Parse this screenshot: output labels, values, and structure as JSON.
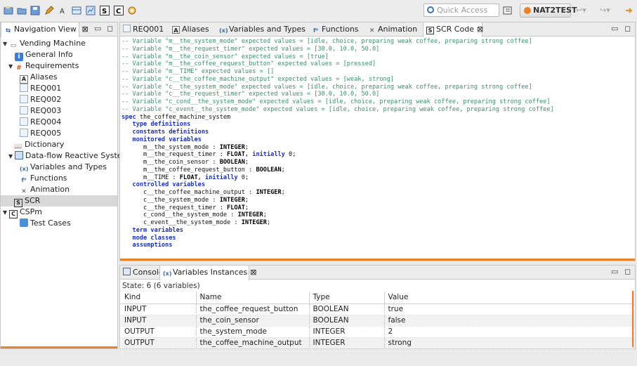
{
  "toolbar": {
    "quick_access_placeholder": "Quick Access",
    "perspective_label": "NAT2TEST"
  },
  "nav": {
    "tab_label": "Navigation View",
    "items": [
      {
        "label": "Vending Machine",
        "icon": "folder-icon"
      },
      {
        "label": "General Info",
        "icon": "info-icon"
      },
      {
        "label": "Requirements",
        "icon": "requirements-icon"
      },
      {
        "label": "Aliases",
        "icon": "aliases-icon"
      },
      {
        "label": "REQ001",
        "icon": "document-icon"
      },
      {
        "label": "REQ002",
        "icon": "document-icon"
      },
      {
        "label": "REQ003",
        "icon": "document-icon"
      },
      {
        "label": "REQ004",
        "icon": "document-icon"
      },
      {
        "label": "REQ005",
        "icon": "document-icon"
      },
      {
        "label": "Dictionary",
        "icon": "dictionary-icon"
      },
      {
        "label": "Data-flow Reactive System",
        "icon": "dfrs-icon"
      },
      {
        "label": "Variables and Types",
        "icon": "variables-icon"
      },
      {
        "label": "Functions",
        "icon": "functions-icon"
      },
      {
        "label": "Animation",
        "icon": "animation-icon"
      },
      {
        "label": "SCR",
        "icon": "scr-icon"
      },
      {
        "label": "CSPm",
        "icon": "cspm-icon"
      },
      {
        "label": "Test Cases",
        "icon": "test-cases-icon"
      }
    ]
  },
  "editor": {
    "tabs": [
      "REQ001",
      "Aliases",
      "Variables and Types",
      "Functions",
      "Animation",
      "SCR Code"
    ],
    "code_lines": [
      {
        "t": "c",
        "s": "-- Variable \"m__the_system_mode\" expected values = [idle, choice, preparing weak coffee, preparing strong coffee]"
      },
      {
        "t": "c",
        "s": "-- Variable \"m__the_request_timer\" expected values = [30.0, 10.0, 50.0]"
      },
      {
        "t": "c",
        "s": "-- Variable \"m__the_coin_sensor\" expected values = [true]"
      },
      {
        "t": "c",
        "s": "-- Variable \"m__the_coffee_request_button\" expected values = [pressed]"
      },
      {
        "t": "c",
        "s": "-- Variable \"m__TIME\" expected values = []"
      },
      {
        "t": "c",
        "s": "-- Variable \"c__the_coffee_machine_output\" expected values = [weak, strong]"
      },
      {
        "t": "c",
        "s": "-- Variable \"c__the_system_mode\" expected values = [idle, choice, preparing weak coffee, preparing strong coffee]"
      },
      {
        "t": "c",
        "s": "-- Variable \"c__the_request_timer\" expected values = [30.0, 10.0, 50.0]"
      },
      {
        "t": "c",
        "s": "-- Variable \"c_cond__the_system_mode\" expected values = [idle, choice, preparing weak coffee, preparing strong coffee]"
      },
      {
        "t": "c",
        "s": "-- Variable \"c_event__the_system_mode\" expected values = [idle, choice, preparing weak coffee, preparing strong coffee]"
      },
      {
        "t": "spec",
        "kw": "spec",
        "s": " the_coffee_machine_system"
      },
      {
        "t": "k",
        "s": "   type definitions"
      },
      {
        "t": "k",
        "s": "   constants definitions"
      },
      {
        "t": "k",
        "s": "   monitored variables"
      },
      {
        "t": "v",
        "s": "      m__the_system_mode : ",
        "ty": "INTEGER",
        "e": ";"
      },
      {
        "t": "v",
        "s": "      m__the_request_timer : ",
        "ty": "FLOAT",
        "i": ", initially",
        "e": " 0;"
      },
      {
        "t": "v",
        "s": "      m__the_coin_sensor : ",
        "ty": "BOOLEAN",
        "e": ";"
      },
      {
        "t": "v",
        "s": "      m__the_coffee_request_button : ",
        "ty": "BOOLEAN",
        "e": ";"
      },
      {
        "t": "v",
        "s": "      m__TIME : ",
        "ty": "FLOAT",
        "i": ", initially",
        "e": " 0;"
      },
      {
        "t": "k",
        "s": "   controlled variables"
      },
      {
        "t": "v",
        "s": "      c__the_coffee_machine_output : ",
        "ty": "INTEGER",
        "e": ";"
      },
      {
        "t": "v",
        "s": "      c__the_system_mode : ",
        "ty": "INTEGER",
        "e": ";"
      },
      {
        "t": "v",
        "s": "      c__the_request_timer : ",
        "ty": "FLOAT",
        "e": ";"
      },
      {
        "t": "v",
        "s": "      c_cond__the_system_mode : ",
        "ty": "INTEGER",
        "e": ";"
      },
      {
        "t": "v",
        "s": "      c_event__the_system_mode : ",
        "ty": "INTEGER",
        "e": ";"
      },
      {
        "t": "k",
        "s": "   term variables"
      },
      {
        "t": "k",
        "s": "   mode classes"
      },
      {
        "t": "k",
        "s": "   assumptions"
      }
    ]
  },
  "bottom": {
    "tabs": [
      "Console",
      "Variables Instances"
    ],
    "state_label": "State: 6 (6 variables)",
    "columns": [
      "Kind",
      "Name",
      "Type",
      "Value"
    ],
    "rows": [
      [
        "INPUT",
        "the_coffee_request_button",
        "BOOLEAN",
        "true"
      ],
      [
        "INPUT",
        "the_coin_sensor",
        "BOOLEAN",
        "false"
      ],
      [
        "OUTPUT",
        "the_system_mode",
        "INTEGER",
        "2"
      ],
      [
        "OUTPUT",
        "the_coffee_machine_output",
        "INTEGER",
        "strong"
      ]
    ]
  },
  "colors": {
    "comment": "#3f8f6b",
    "keyword": "#1a2fbf",
    "accent_orange": "#e8832a"
  }
}
